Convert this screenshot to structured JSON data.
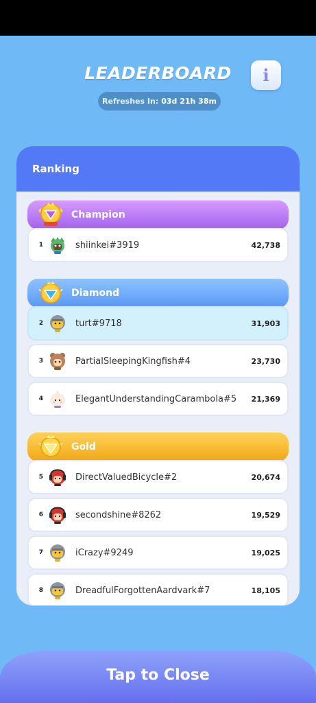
{
  "header": {
    "title": "LEADERBOARD",
    "refresh_label": "Refreshes In:",
    "refresh_value": "03d 21h 38m",
    "info_icon": "info-icon"
  },
  "panel": {
    "title": "Ranking"
  },
  "tiers": {
    "champion": {
      "name": "Champion",
      "icon": "trophy-gem-icon"
    },
    "diamond": {
      "name": "Diamond",
      "icon": "winged-diamond-icon"
    },
    "gold": {
      "name": "Gold",
      "icon": "winged-gold-gem-icon"
    }
  },
  "rows": [
    {
      "rank": "1",
      "name": "shiinkei#3919",
      "score": "42,738",
      "avatar": "green-monster-avatar"
    },
    {
      "rank": "2",
      "name": "turt#9718",
      "score": "31,903",
      "avatar": "knight-helmet-avatar"
    },
    {
      "rank": "3",
      "name": "PartialSleepingKingfish#4",
      "score": "23,730",
      "avatar": "bear-hood-avatar"
    },
    {
      "rank": "4",
      "name": "ElegantUnderstandingCarambola#5",
      "score": "21,369",
      "avatar": "dumpling-avatar"
    },
    {
      "rank": "5",
      "name": "DirectValuedBicycle#2",
      "score": "20,674",
      "avatar": "red-hair-headphones-avatar"
    },
    {
      "rank": "6",
      "name": "secondshine#8262",
      "score": "19,529",
      "avatar": "red-hair-headphones-avatar"
    },
    {
      "rank": "7",
      "name": "iCrazy#9249",
      "score": "19,025",
      "avatar": "knight-helmet-avatar"
    },
    {
      "rank": "8",
      "name": "DreadfulForgottenAardvark#7",
      "score": "18,105",
      "avatar": "knight-helmet-avatar"
    }
  ],
  "footer": {
    "close_label": "Tap to Close"
  },
  "colors": {
    "background": "#6fb9f7",
    "panel_header": "#5479f6",
    "highlight_row": "#d3f0fd",
    "champion": "#b878f2",
    "diamond": "#6fa9f8",
    "gold": "#f4b52a"
  }
}
